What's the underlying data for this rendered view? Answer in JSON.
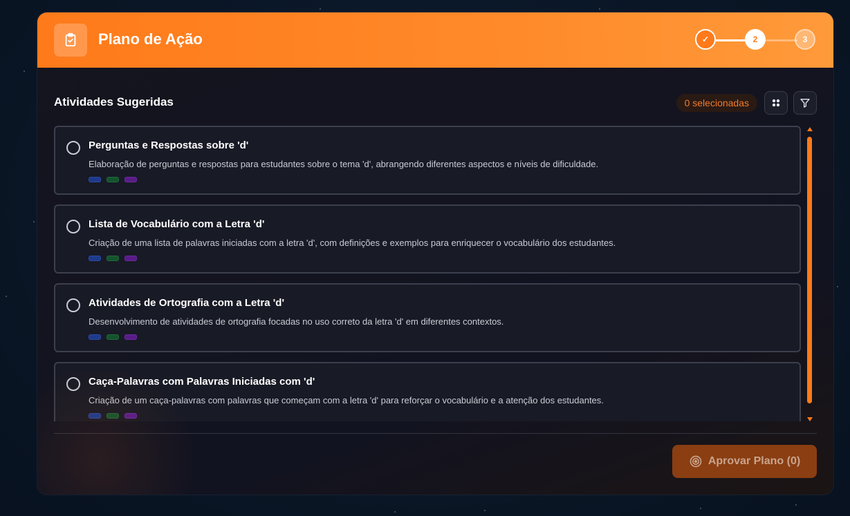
{
  "header": {
    "title": "Plano de Ação",
    "icon": "clipboard-check-icon",
    "steps": [
      {
        "label": "✓",
        "state": "done"
      },
      {
        "label": "2",
        "state": "current"
      },
      {
        "label": "3",
        "state": "pending"
      }
    ]
  },
  "section": {
    "title": "Atividades Sugeridas",
    "selected_badge": "0 selecionadas",
    "grid_icon": "grid-icon",
    "filter_icon": "filter-icon"
  },
  "activities": [
    {
      "title": "Perguntas e Respostas sobre 'd'",
      "description": "Elaboração de perguntas e respostas para estudantes sobre o tema 'd', abrangendo diferentes aspectos e níveis de dificuldade."
    },
    {
      "title": "Lista de Vocabulário com a Letra 'd'",
      "description": "Criação de uma lista de palavras iniciadas com a letra 'd', com definições e exemplos para enriquecer o vocabulário dos estudantes."
    },
    {
      "title": "Atividades de Ortografia com a Letra 'd'",
      "description": "Desenvolvimento de atividades de ortografia focadas no uso correto da letra 'd' em diferentes contextos."
    },
    {
      "title": "Caça-Palavras com Palavras Iniciadas com 'd'",
      "description": "Criação de um caça-palavras com palavras que começam com a letra 'd' para reforçar o vocabulário e a atenção dos estudantes."
    }
  ],
  "tag_colors": [
    "#1e3a8a",
    "#14532d",
    "#581c87"
  ],
  "footer": {
    "approve_label": "Aprovar Plano (0)",
    "approve_icon": "target-icon"
  },
  "colors": {
    "accent": "#ff7a1a"
  }
}
